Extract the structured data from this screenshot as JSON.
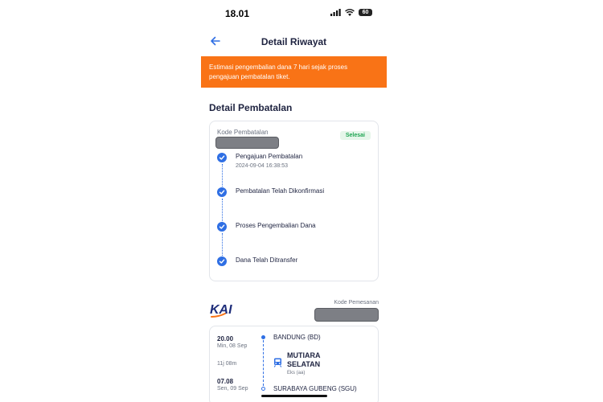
{
  "status_bar": {
    "time": "18.01",
    "battery": "60"
  },
  "header": {
    "title": "Detail Riwayat"
  },
  "banner": {
    "text": "Estimasi pengembalian dana 7 hari sejak proses pengajuan pembatalan tiket."
  },
  "cancellation": {
    "section_title": "Detail Pembatalan",
    "code_label": "Kode Pembatalan",
    "status_badge": "Selesai",
    "steps": [
      {
        "label": "Pengajuan Pembatalan",
        "date": "2024-09-04 16:38:53"
      },
      {
        "label": "Pembatalan Telah Dikonfirmasi"
      },
      {
        "label": "Proses Pengembalian Dana"
      },
      {
        "label": "Dana Telah Ditransfer"
      }
    ]
  },
  "order": {
    "logo_text": "KAI",
    "code_label": "Kode Pemesanan"
  },
  "trip": {
    "departure": {
      "time": "20.00",
      "date": "Min, 08 Sep",
      "station": "BANDUNG (BD)"
    },
    "duration": "11j 08m",
    "arrival": {
      "time": "07.08",
      "date": "Sen, 09 Sep",
      "station": "SURABAYA GUBENG (SGU)"
    },
    "train_name_line1": "MUTIARA",
    "train_name_line2": "SELATAN",
    "train_class": "Eks (aa)"
  },
  "colors": {
    "accent": "#2f6fe4",
    "banner": "#f97316",
    "success": "#1fa552"
  },
  "icons": [
    "back-arrow-icon",
    "signal-icon",
    "wifi-icon",
    "battery-icon",
    "check-circle-icon",
    "train-icon"
  ]
}
